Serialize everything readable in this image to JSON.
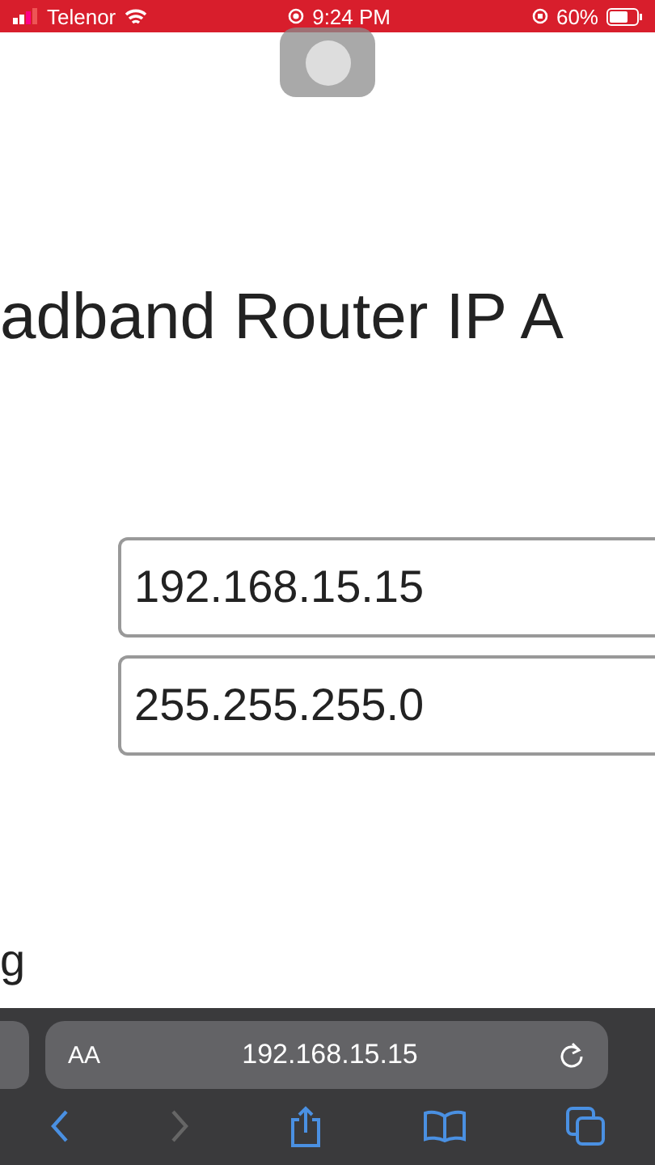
{
  "status_bar": {
    "carrier": "Telenor",
    "time": "9:24 PM",
    "battery": "60%"
  },
  "page": {
    "heading": "adband Router IP A",
    "fields": [
      {
        "value": "192.168.15.15"
      },
      {
        "value": "255.255.255.0"
      }
    ],
    "footer_text": "g"
  },
  "browser_bar": {
    "text_size_button": "AA",
    "address": "192.168.15.15"
  }
}
